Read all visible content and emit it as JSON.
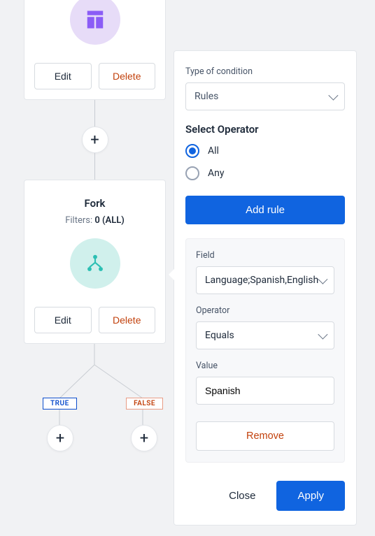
{
  "node1": {
    "edit_label": "Edit",
    "delete_label": "Delete"
  },
  "node2": {
    "title": "Fork",
    "filters_prefix": "Filters: ",
    "filters_value": "0 (ALL)",
    "edit_label": "Edit",
    "delete_label": "Delete"
  },
  "branch": {
    "true_label": "TRUE",
    "false_label": "FALSE"
  },
  "panel": {
    "type_label": "Type of condition",
    "type_value": "Rules",
    "operator_section": "Select Operator",
    "operator_all": "All",
    "operator_any": "Any",
    "add_rule": "Add rule",
    "rule": {
      "field_label": "Field",
      "field_value": "Language;Spanish,English",
      "operator_label": "Operator",
      "operator_value": "Equals",
      "value_label": "Value",
      "value_value": "Spanish",
      "remove_label": "Remove"
    },
    "close_label": "Close",
    "apply_label": "Apply"
  }
}
